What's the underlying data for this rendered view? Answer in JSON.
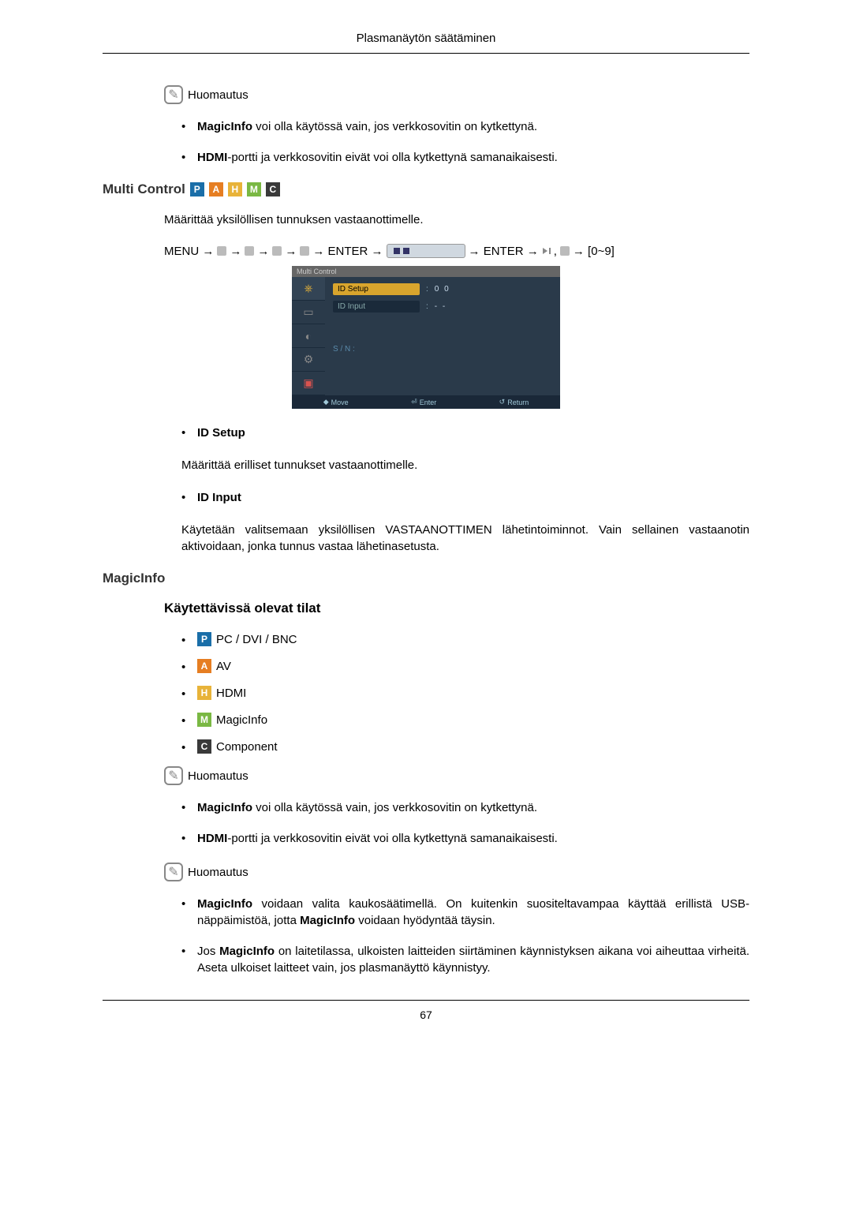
{
  "header": {
    "title": "Plasmanäytön säätäminen"
  },
  "note_label": "Huomautus",
  "notes1": {
    "item1_bold": "MagicInfo",
    "item1_rest": " voi olla käytössä vain, jos verkkosovitin on kytkettynä.",
    "item2_bold": "HDMI",
    "item2_rest": "-portti ja verkkosovitin eivät voi olla kytkettynä samanaikaisesti."
  },
  "multi_control": {
    "heading": "Multi Control",
    "intro": "Määrittää yksilöllisen tunnuksen vastaanottimelle.",
    "path_menu": "MENU → ",
    "path_enter1": " → ENTER → ",
    "path_enter2": " → ENTER → ",
    "path_tail": " → [0~9]"
  },
  "osd": {
    "title": "Multi Control",
    "row1_label": "ID  Setup",
    "row1_val": "0 0",
    "row2_label": "ID  Input",
    "row2_val": "- -",
    "sn": "S / N  :",
    "footer_move": "Move",
    "footer_enter": "Enter",
    "footer_return": "Return"
  },
  "id_setup": {
    "label": "ID Setup",
    "desc": "Määrittää erilliset tunnukset vastaanottimelle."
  },
  "id_input": {
    "label": "ID Input",
    "desc": "Käytetään valitsemaan yksilöllisen VASTAANOTTIMEN lähetintoiminnot. Vain sellainen vastaanotin aktivoidaan, jonka tunnus vastaa lähetinasetusta."
  },
  "magicinfo": {
    "heading": "MagicInfo",
    "subheading": "Käytettävissä olevat tilat",
    "modes": {
      "pc": "PC / DVI / BNC",
      "av": "AV",
      "hdmi": "HDMI",
      "mi": "MagicInfo",
      "comp": "Component"
    }
  },
  "notes3": {
    "item1a": "MagicInfo",
    "item1b": " voidaan valita kaukosäätimellä. On kuitenkin suositeltavampaa käyttää erillistä USB-näppäimistöä, jotta ",
    "item1c": "MagicInfo",
    "item1d": " voidaan hyödyntää täysin.",
    "item2a": "Jos ",
    "item2b": "MagicInfo",
    "item2c": " on laitetilassa, ulkoisten laitteiden siirtäminen käynnistyksen aikana voi aiheuttaa virheitä. Aseta ulkoiset laitteet vain, jos plasmanäyttö käynnistyy."
  },
  "page_number": "67"
}
